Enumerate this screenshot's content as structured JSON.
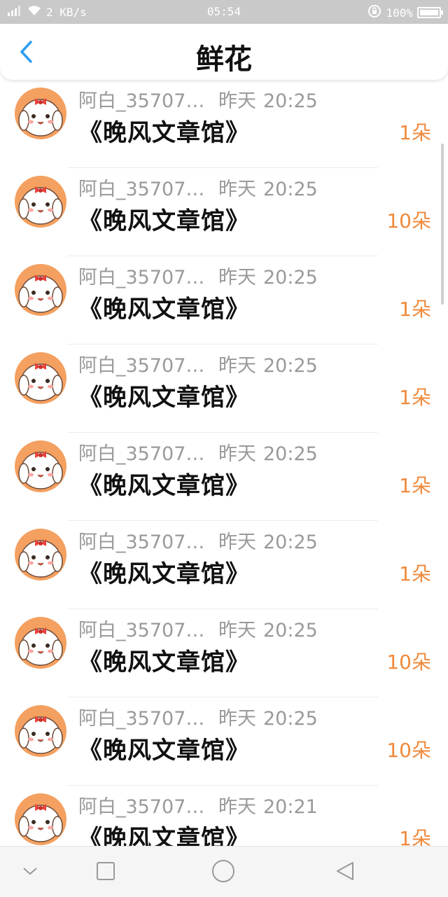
{
  "status_bar": {
    "network_speed": "2 KB/s",
    "time": "05:54",
    "battery": "100%",
    "battery_level": 1.0,
    "icons": [
      "signal-icon",
      "wifi-icon",
      "rotation-lock-icon",
      "battery-icon"
    ]
  },
  "header": {
    "title": "鲜花",
    "back_icon": "chevron-left-icon"
  },
  "colors": {
    "count": "#f08a3c",
    "meta": "#9a9a9a",
    "back": "#2f9ef0",
    "statusbar": "#c9c9c9"
  },
  "items": [
    {
      "name": "阿白_35707…",
      "date": "昨天",
      "time": "20:25",
      "work": "《晚风文章馆》",
      "count": "1朵"
    },
    {
      "name": "阿白_35707…",
      "date": "昨天",
      "time": "20:25",
      "work": "《晚风文章馆》",
      "count": "10朵"
    },
    {
      "name": "阿白_35707…",
      "date": "昨天",
      "time": "20:25",
      "work": "《晚风文章馆》",
      "count": "1朵"
    },
    {
      "name": "阿白_35707…",
      "date": "昨天",
      "time": "20:25",
      "work": "《晚风文章馆》",
      "count": "1朵"
    },
    {
      "name": "阿白_35707…",
      "date": "昨天",
      "time": "20:25",
      "work": "《晚风文章馆》",
      "count": "1朵"
    },
    {
      "name": "阿白_35707…",
      "date": "昨天",
      "time": "20:25",
      "work": "《晚风文章馆》",
      "count": "1朵"
    },
    {
      "name": "阿白_35707…",
      "date": "昨天",
      "time": "20:25",
      "work": "《晚风文章馆》",
      "count": "10朵"
    },
    {
      "name": "阿白_35707…",
      "date": "昨天",
      "time": "20:25",
      "work": "《晚风文章馆》",
      "count": "10朵"
    },
    {
      "name": "阿白_35707…",
      "date": "昨天",
      "time": "20:21",
      "work": "《晚风文章馆》",
      "count": "1朵"
    }
  ],
  "nav_bar": {
    "buttons": [
      "chevron-down-icon",
      "square-icon",
      "circle-icon",
      "triangle-back-icon"
    ]
  }
}
